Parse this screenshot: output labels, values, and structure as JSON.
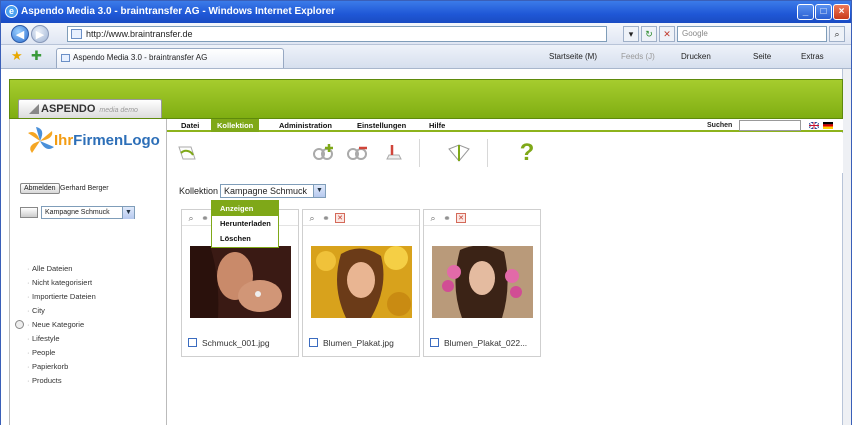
{
  "window": {
    "title": "Aspendo Media 3.0 - braintransfer AG - Windows Internet Explorer"
  },
  "browser": {
    "url": "http://www.braintransfer.de",
    "search_placeholder": "Google",
    "tab_title": "Aspendo Media 3.0 - braintransfer AG",
    "commands": [
      "Startseite (M)",
      "Feeds (J)",
      "Drucken",
      "Seite",
      "Extras"
    ]
  },
  "app": {
    "logo_text": "ASPENDO",
    "logo_sub": "media demo",
    "company_logo_a": "Ihr",
    "company_logo_b": "Firmen",
    "company_logo_c": "Logo",
    "logout_label": "Abmelden",
    "user_name": "Gerhard Berger",
    "collection_select": "Kampagne Schmuck",
    "menu": [
      "Datei",
      "Kollektion",
      "Administration",
      "Einstellungen",
      "Hilfe"
    ],
    "search_label": "Suchen",
    "dropdown": [
      "Anzeigen",
      "Herunterladen",
      "Löschen"
    ],
    "kollektion_label": "Kollektion",
    "kollektion_value": "Kampagne Schmuck",
    "nav": [
      "Alle Dateien",
      "Nicht kategorisiert",
      "Importierte Dateien",
      "City",
      "Neue Kategorie",
      "Lifestyle",
      "People",
      "Papierkorb",
      "Products"
    ],
    "cards": [
      {
        "filename": "Schmuck_001.jpg"
      },
      {
        "filename": "Blumen_Plakat.jpg"
      },
      {
        "filename": "Blumen_Plakat_022..."
      }
    ],
    "accent": "#7fa818"
  }
}
